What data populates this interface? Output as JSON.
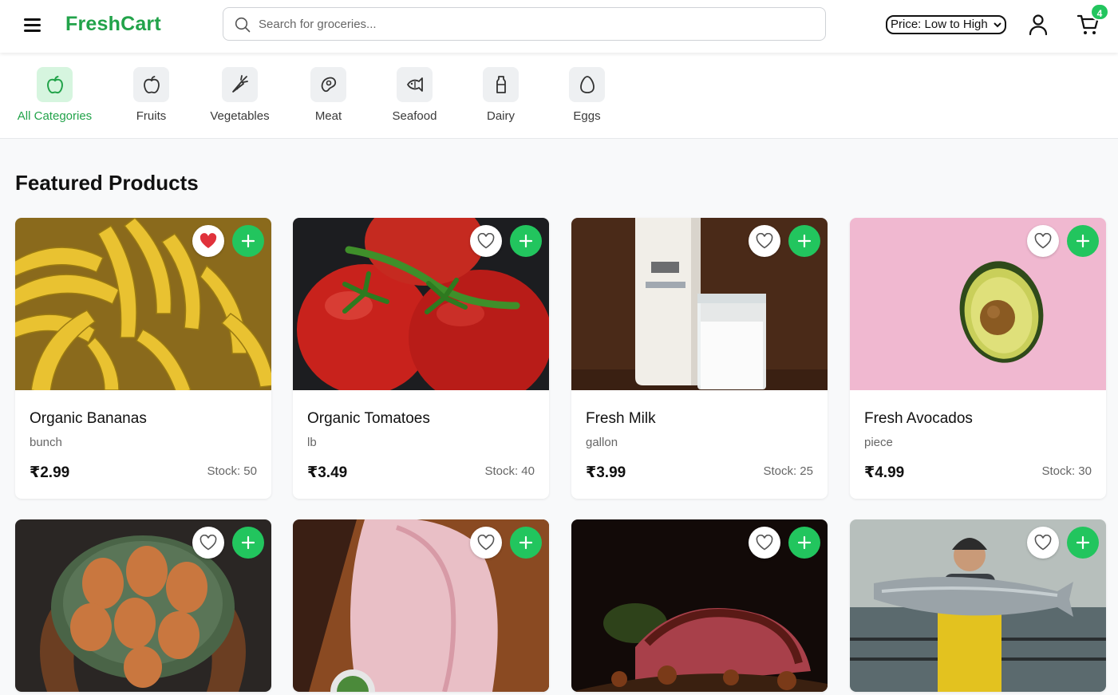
{
  "app": {
    "logo": "FreshCart"
  },
  "search": {
    "placeholder": "Search for groceries..."
  },
  "sort": {
    "selected": "Price: Low to High"
  },
  "cart": {
    "count": "4"
  },
  "categories": [
    {
      "label": "All Categories",
      "icon": "apple-icon",
      "active": true
    },
    {
      "label": "Fruits",
      "icon": "apple-icon",
      "active": false
    },
    {
      "label": "Vegetables",
      "icon": "carrot-icon",
      "active": false
    },
    {
      "label": "Meat",
      "icon": "steak-icon",
      "active": false
    },
    {
      "label": "Seafood",
      "icon": "fish-icon",
      "active": false
    },
    {
      "label": "Dairy",
      "icon": "milk-bottle-icon",
      "active": false
    },
    {
      "label": "Eggs",
      "icon": "egg-icon",
      "active": false
    }
  ],
  "main": {
    "title": "Featured Products"
  },
  "products": [
    {
      "name": "Organic Bananas",
      "unit": "bunch",
      "price": "₹2.99",
      "stock": "Stock: 50",
      "favorite": true
    },
    {
      "name": "Organic Tomatoes",
      "unit": "lb",
      "price": "₹3.49",
      "stock": "Stock: 40",
      "favorite": false
    },
    {
      "name": "Fresh Milk",
      "unit": "gallon",
      "price": "₹3.99",
      "stock": "Stock: 25",
      "favorite": false
    },
    {
      "name": "Fresh Avocados",
      "unit": "piece",
      "price": "₹4.99",
      "stock": "Stock: 30",
      "favorite": false
    },
    {
      "favorite": false
    },
    {
      "favorite": false
    },
    {
      "favorite": false
    },
    {
      "favorite": false
    }
  ],
  "colors": {
    "brand": "#22a34a",
    "accent": "#22c55e",
    "favorite": "#e0323c"
  }
}
